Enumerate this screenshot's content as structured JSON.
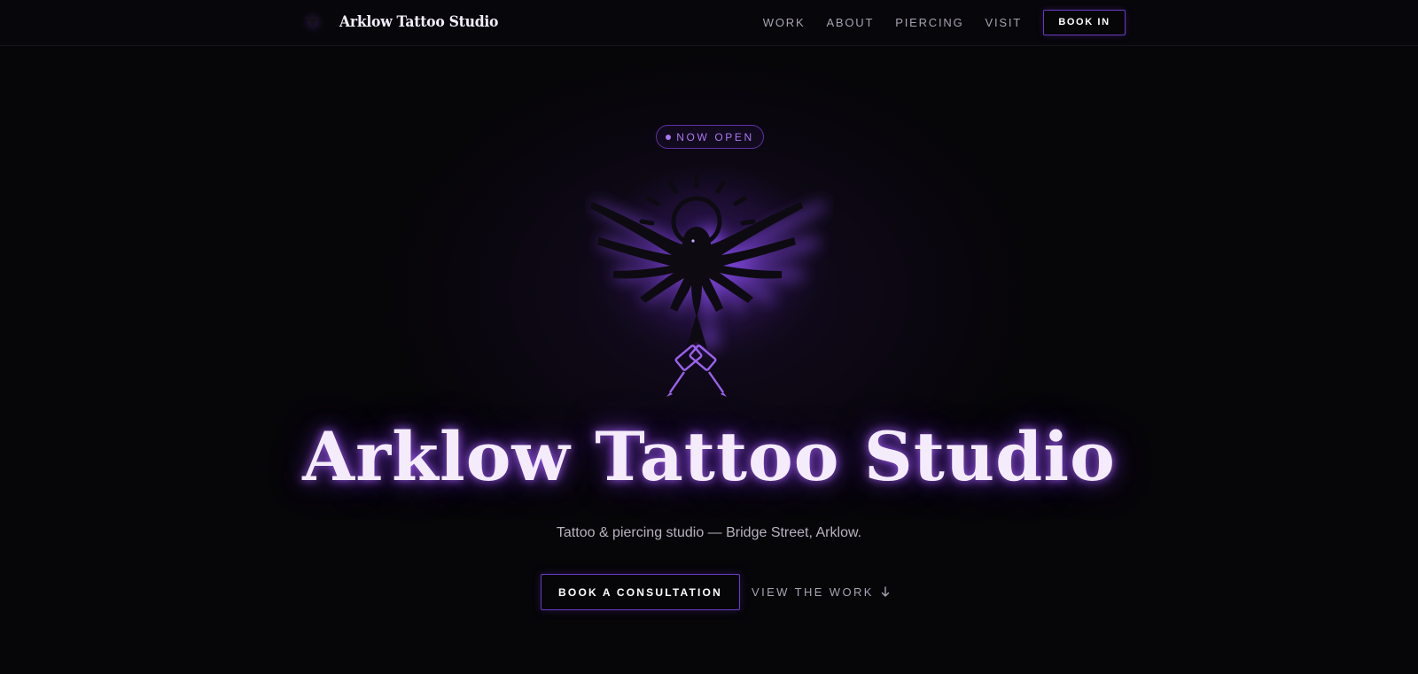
{
  "brand": {
    "name": "Arklow Tattoo Studio",
    "logo_icon": "crow-emblem-icon"
  },
  "nav": {
    "links": [
      {
        "label": "WORK"
      },
      {
        "label": "ABOUT"
      },
      {
        "label": "PIERCING"
      },
      {
        "label": "VISIT"
      }
    ],
    "cta_label": "BOOK IN"
  },
  "hero": {
    "badge": "NOW OPEN",
    "emblem_icon": "winged-crow-with-tattoo-machines-icon",
    "title": "Arklow Tattoo Studio",
    "subtitle": "Tattoo & piercing studio — Bridge Street, Arklow.",
    "primary_button": "BOOK A CONSULTATION",
    "secondary_link": "VIEW THE WORK",
    "secondary_icon": "arrow-down-icon"
  },
  "colors": {
    "background": "#060508",
    "accent": "#6a3bc4",
    "accent_light": "#a978f0",
    "text": "#f4ecfb"
  }
}
